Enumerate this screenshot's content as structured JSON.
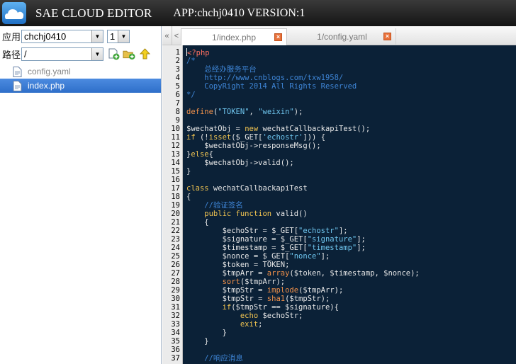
{
  "titlebar": {
    "title": "SAE CLOUD EDITOR",
    "app_info": "APP:chchj0410  VERSION:1"
  },
  "left": {
    "app_label": "应用",
    "app_value": "chchj0410",
    "version_value": "1",
    "path_label": "路径",
    "path_value": "/",
    "files": [
      {
        "name": "config.yaml",
        "selected": false
      },
      {
        "name": "index.php",
        "selected": true
      }
    ]
  },
  "tabs": {
    "collapse_glyph": "«",
    "scroll_glyph": "<",
    "items": [
      {
        "label": "1/index.php",
        "active": true
      },
      {
        "label": "1/config.yaml",
        "active": false
      }
    ]
  },
  "icons": {
    "logo": "cloud-logo-icon",
    "new_file": "new-file-icon",
    "new_folder": "new-folder-icon",
    "up": "up-arrow-icon",
    "file": "file-icon",
    "close": "close-tab-icon"
  },
  "colors": {
    "editor_bg": "#0b2137",
    "keyword": "#f1c451",
    "function": "#f0904a",
    "string": "#6fc6ef",
    "comment": "#3e85d6",
    "selected_file": "#2e6fc9"
  },
  "editor": {
    "lines": [
      [
        [
          "p",
          "<?php"
        ]
      ],
      [
        [
          "c",
          "/*"
        ]
      ],
      [
        [
          "c",
          "    总经办服务平台"
        ]
      ],
      [
        [
          "c",
          "    http://www.cnblogs.com/txw1958/"
        ]
      ],
      [
        [
          "c",
          "    CopyRight 2014 All Rights Reserved"
        ]
      ],
      [
        [
          "c",
          "*/"
        ]
      ],
      [],
      [
        [
          "f",
          "define"
        ],
        [
          "v",
          "("
        ],
        [
          "s",
          "\"TOKEN\""
        ],
        [
          "v",
          ", "
        ],
        [
          "s",
          "\"weixin\""
        ],
        [
          "v",
          ");"
        ]
      ],
      [],
      [
        [
          "v",
          "$wechatObj = "
        ],
        [
          "k",
          "new"
        ],
        [
          "v",
          " wechatCallbackapiTest();"
        ]
      ],
      [
        [
          "k",
          "if"
        ],
        [
          "v",
          " (!"
        ],
        [
          "k",
          "isset"
        ],
        [
          "v",
          "($_GET["
        ],
        [
          "s",
          "'echostr'"
        ],
        [
          "v",
          "])) {"
        ]
      ],
      [
        [
          "v",
          "    $wechatObj->responseMsg();"
        ]
      ],
      [
        [
          "v",
          "}"
        ],
        [
          "k",
          "else"
        ],
        [
          "v",
          "{"
        ]
      ],
      [
        [
          "v",
          "    $wechatObj->valid();"
        ]
      ],
      [
        [
          "v",
          "}"
        ]
      ],
      [],
      [
        [
          "k",
          "class"
        ],
        [
          "v",
          " wechatCallbackapiTest"
        ]
      ],
      [
        [
          "v",
          "{"
        ]
      ],
      [
        [
          "c",
          "    //验证签名"
        ]
      ],
      [
        [
          "k",
          "    public function"
        ],
        [
          "v",
          " valid()"
        ]
      ],
      [
        [
          "v",
          "    {"
        ]
      ],
      [
        [
          "v",
          "        $echoStr = $_GET["
        ],
        [
          "s",
          "\"echostr\""
        ],
        [
          "v",
          "];"
        ]
      ],
      [
        [
          "v",
          "        $signature = $_GET["
        ],
        [
          "s",
          "\"signature\""
        ],
        [
          "v",
          "];"
        ]
      ],
      [
        [
          "v",
          "        $timestamp = $_GET["
        ],
        [
          "s",
          "\"timestamp\""
        ],
        [
          "v",
          "];"
        ]
      ],
      [
        [
          "v",
          "        $nonce = $_GET["
        ],
        [
          "s",
          "\"nonce\""
        ],
        [
          "v",
          "];"
        ]
      ],
      [
        [
          "v",
          "        $token = TOKEN;"
        ]
      ],
      [
        [
          "v",
          "        $tmpArr = "
        ],
        [
          "f",
          "array"
        ],
        [
          "v",
          "($token, $timestamp, $nonce);"
        ]
      ],
      [
        [
          "f",
          "        sort"
        ],
        [
          "v",
          "($tmpArr);"
        ]
      ],
      [
        [
          "v",
          "        $tmpStr = "
        ],
        [
          "f",
          "implode"
        ],
        [
          "v",
          "($tmpArr);"
        ]
      ],
      [
        [
          "v",
          "        $tmpStr = "
        ],
        [
          "f",
          "sha1"
        ],
        [
          "v",
          "($tmpStr);"
        ]
      ],
      [
        [
          "k",
          "        if"
        ],
        [
          "v",
          "($tmpStr == $signature){"
        ]
      ],
      [
        [
          "k",
          "            echo"
        ],
        [
          "v",
          " $echoStr;"
        ]
      ],
      [
        [
          "k",
          "            exit"
        ],
        [
          "v",
          ";"
        ]
      ],
      [
        [
          "v",
          "        }"
        ]
      ],
      [
        [
          "v",
          "    }"
        ]
      ],
      [],
      [
        [
          "c",
          "    //响应消息"
        ]
      ]
    ]
  }
}
